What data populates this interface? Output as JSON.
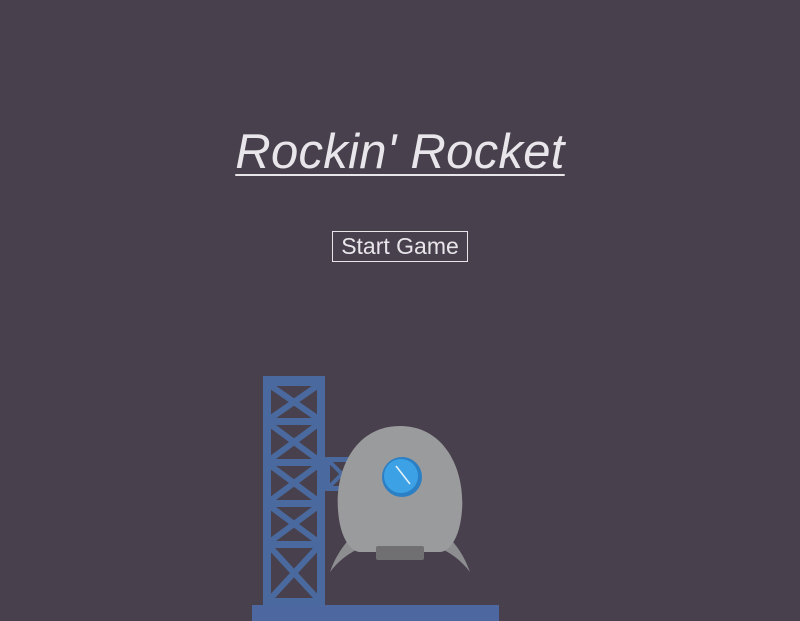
{
  "game": {
    "title": "Rockin' Rocket",
    "start_button_label": "Start Game"
  },
  "colors": {
    "background": "#48414d",
    "text": "#e8e6ea",
    "tower": "#4a6a9f",
    "tower_dark": "#3c5a8c",
    "rocket_body": "#9a9b9c",
    "rocket_fins": "#8d8e90",
    "rocket_nozzle": "#707073",
    "porthole": "#3da2e5",
    "porthole_rim": "#2b7fc4",
    "ground": "#4d68a0"
  },
  "scene": {
    "launch_tower": {
      "icon": "launch-tower"
    },
    "rocket": {
      "icon": "rocket"
    },
    "launch_pad": {
      "icon": "launch-pad"
    }
  }
}
